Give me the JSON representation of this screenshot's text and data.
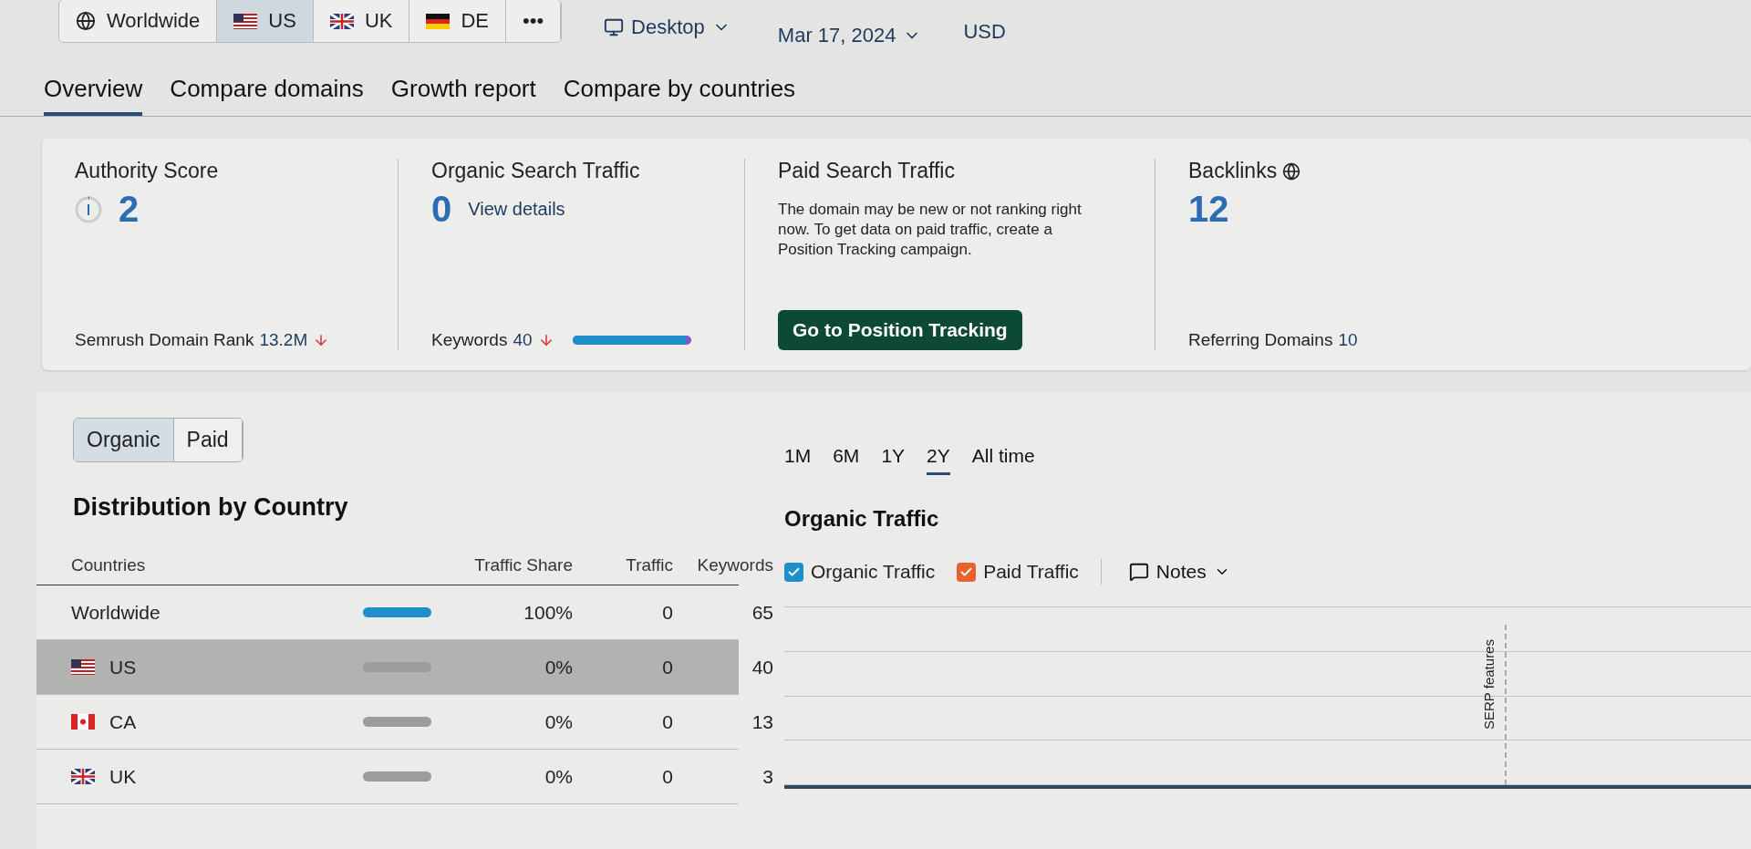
{
  "databases": [
    {
      "label": "Worldwide",
      "kind": "globe",
      "selected": false
    },
    {
      "label": "US",
      "kind": "us",
      "selected": true
    },
    {
      "label": "UK",
      "kind": "uk",
      "selected": false
    },
    {
      "label": "DE",
      "kind": "de",
      "selected": false
    },
    {
      "label": "•••",
      "kind": "more",
      "selected": false
    }
  ],
  "device": "Desktop",
  "date": "Mar 17, 2024",
  "currency": "USD",
  "tabs": [
    {
      "label": "Overview",
      "selected": true
    },
    {
      "label": "Compare domains",
      "selected": false
    },
    {
      "label": "Growth report",
      "selected": false
    },
    {
      "label": "Compare by countries",
      "selected": false
    }
  ],
  "metrics": {
    "authority": {
      "title": "Authority Score",
      "value": "2",
      "footer_label": "Semrush Domain Rank",
      "footer_value": "13.2M"
    },
    "organic": {
      "title": "Organic Search Traffic",
      "value": "0",
      "link": "View details",
      "footer_label": "Keywords",
      "footer_value": "40",
      "level": 0.96
    },
    "paid": {
      "title": "Paid Search Traffic",
      "text": "The domain may be new or not ranking right now. To get data on paid traffic, create a Position Tracking campaign.",
      "button": "Go to Position Tracking"
    },
    "backlinks": {
      "title": "Backlinks",
      "value": "12",
      "footer_label": "Referring Domains",
      "footer_value": "10"
    }
  },
  "mode_toggle": [
    {
      "label": "Organic",
      "selected": true
    },
    {
      "label": "Paid",
      "selected": false
    }
  ],
  "distribution": {
    "title": "Distribution by Country",
    "columns": [
      "Countries",
      "Traffic Share",
      "Traffic",
      "Keywords"
    ],
    "rows": [
      {
        "country": "Worldwide",
        "kind": "none",
        "level": 1,
        "share": "100%",
        "traffic": "0",
        "keywords": "65",
        "selected": false
      },
      {
        "country": "US",
        "kind": "us",
        "level": 0,
        "share": "0%",
        "traffic": "0",
        "keywords": "40",
        "selected": true
      },
      {
        "country": "CA",
        "kind": "ca",
        "level": 0,
        "share": "0%",
        "traffic": "0",
        "keywords": "13",
        "selected": false
      },
      {
        "country": "UK",
        "kind": "uk",
        "level": 0,
        "share": "0%",
        "traffic": "0",
        "keywords": "3",
        "selected": false
      }
    ]
  },
  "periods": [
    {
      "label": "1M",
      "selected": false
    },
    {
      "label": "6M",
      "selected": false
    },
    {
      "label": "1Y",
      "selected": false
    },
    {
      "label": "2Y",
      "selected": true
    },
    {
      "label": "All time",
      "selected": false
    }
  ],
  "chart": {
    "title": "Organic Traffic",
    "legend": [
      {
        "label": "Organic Traffic",
        "checked": true,
        "color": "#1f8fc9"
      },
      {
        "label": "Paid Traffic",
        "checked": true,
        "color": "#e8622c"
      }
    ],
    "notes": "Notes",
    "marker": "SERP features"
  }
}
